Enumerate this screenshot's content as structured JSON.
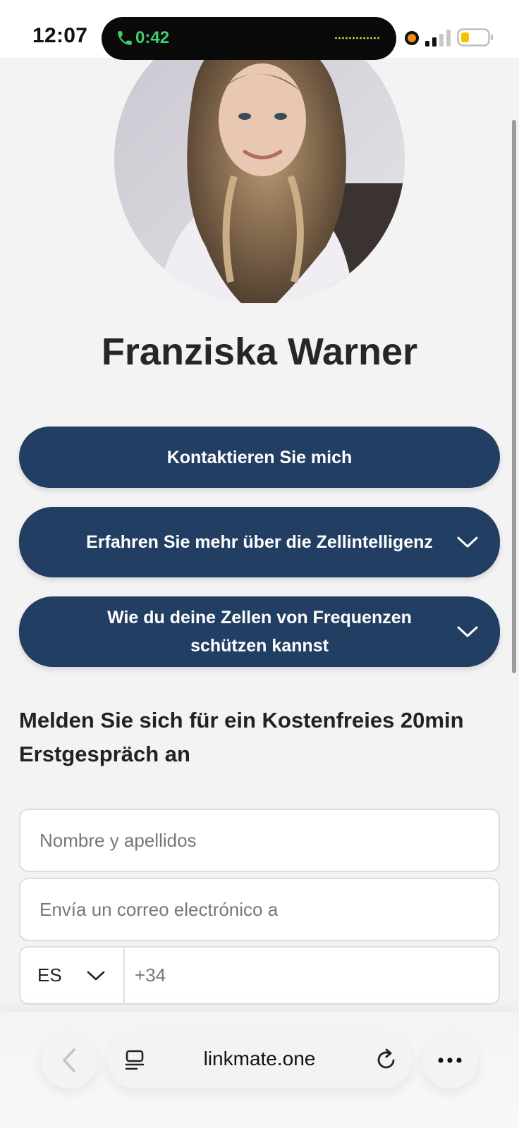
{
  "status_bar": {
    "time": "12:07",
    "call_duration": "0:42",
    "call_icon": "phone-icon",
    "accent_call_color": "#3bd16f",
    "recording_dot_color": "#f08a18"
  },
  "profile": {
    "name": "Franziska Warner",
    "avatar_icon": "profile-photo"
  },
  "buttons": [
    {
      "label": "Kontaktieren Sie mich",
      "color": "#223e62"
    },
    {
      "label": "Erfahren Sie mehr über die Zellintelligenz",
      "icon": "chevron-down-icon"
    },
    {
      "label": "Wie du deine Zellen von Frequenzen schützen kannst",
      "icon": "chevron-down-icon"
    }
  ],
  "form": {
    "heading": "Melden Sie sich für ein Kostenfreies 20min Erstgespräch an",
    "name_placeholder": "Nombre y apellidos",
    "email_placeholder": "Envía un correo electrónico a",
    "country_code": "ES",
    "phone_placeholder": "+34"
  },
  "browser": {
    "url": "linkmate.one",
    "back_icon": "chevron-left-icon",
    "tabs_icon": "tabs-icon",
    "reload_icon": "reload-icon",
    "more_icon": "more-icon"
  }
}
